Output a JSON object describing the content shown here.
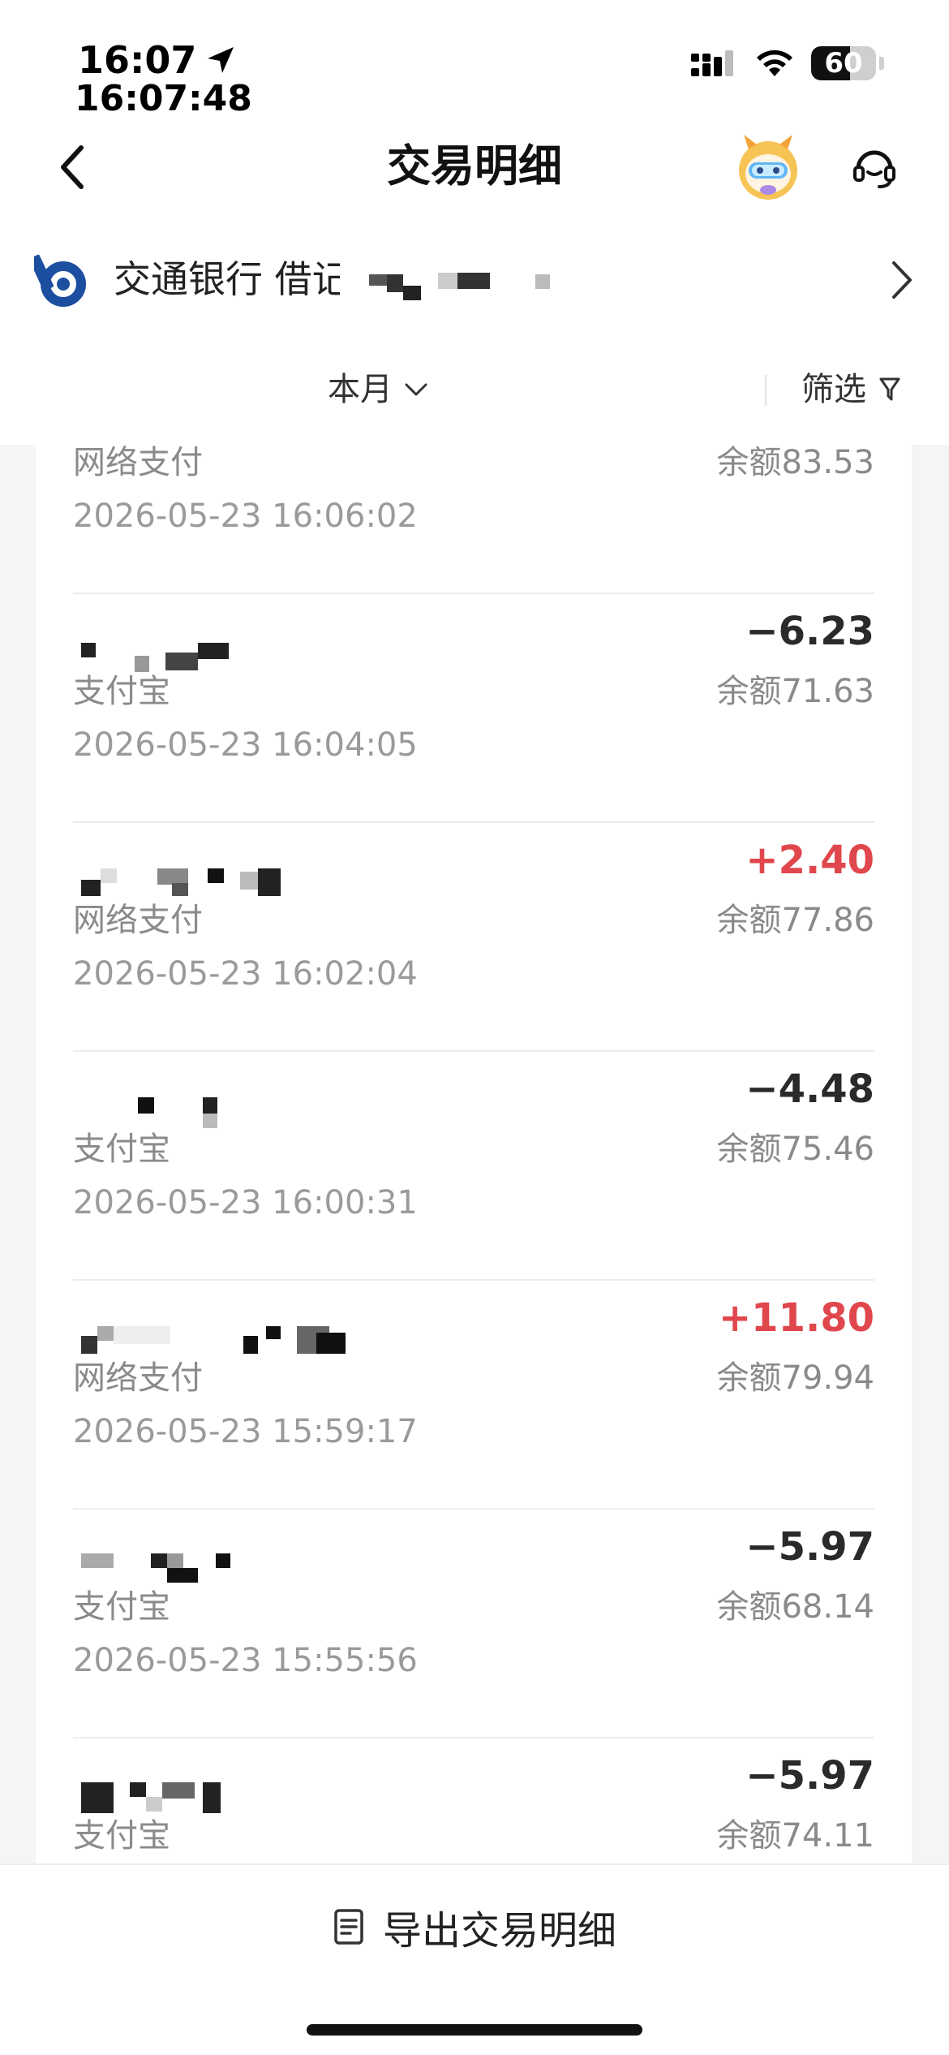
{
  "status_bar": {
    "time": "16:07",
    "time_seconds": "16:07:48",
    "battery": "60",
    "battery_level": 0.6
  },
  "nav": {
    "title": "交易明细"
  },
  "account": {
    "bank": "交通银行",
    "card_type": "借记卡"
  },
  "filter": {
    "period": "本月",
    "filter_label": "筛选"
  },
  "transactions": [
    {
      "amount": "",
      "channel": "网络支付",
      "balance": "余额83.53",
      "time": "2026-05-23 16:06:02",
      "sign": "neg"
    },
    {
      "amount": "−6.23",
      "channel": "支付宝",
      "balance": "余额71.63",
      "time": "2026-05-23 16:04:05",
      "sign": "neg"
    },
    {
      "amount": "+2.40",
      "channel": "网络支付",
      "balance": "余额77.86",
      "time": "2026-05-23 16:02:04",
      "sign": "pos"
    },
    {
      "amount": "−4.48",
      "channel": "支付宝",
      "balance": "余额75.46",
      "time": "2026-05-23 16:00:31",
      "sign": "neg"
    },
    {
      "amount": "+11.80",
      "channel": "网络支付",
      "balance": "余额79.94",
      "time": "2026-05-23 15:59:17",
      "sign": "pos"
    },
    {
      "amount": "−5.97",
      "channel": "支付宝",
      "balance": "余额68.14",
      "time": "2026-05-23 15:55:56",
      "sign": "neg"
    },
    {
      "amount": "−5.97",
      "channel": "支付宝",
      "balance": "余额74.11",
      "time": "",
      "sign": "neg"
    }
  ],
  "bottom": {
    "export_label": "导出交易明细"
  },
  "colors": {
    "positive": "#e0474c",
    "negative": "#2a2a2a",
    "bank_blue": "#1d4fa0"
  }
}
